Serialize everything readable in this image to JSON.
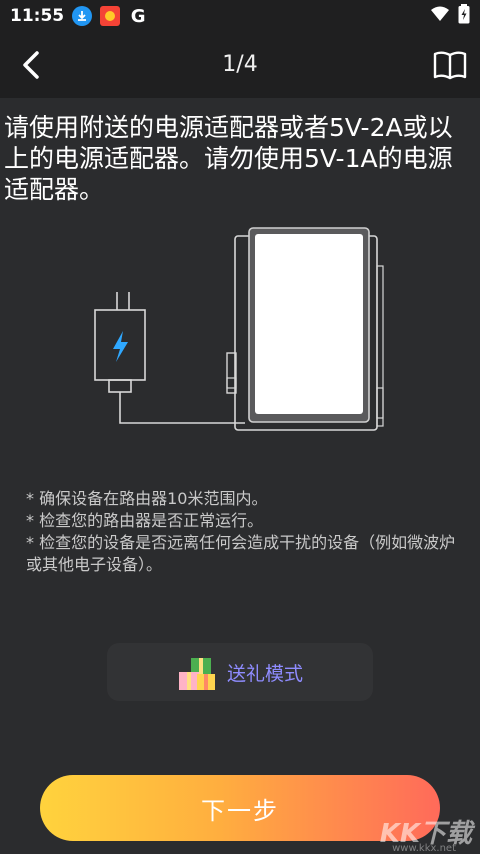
{
  "status_bar": {
    "time": "11:55",
    "icons": [
      "download-icon",
      "app-notification-icon",
      "google-icon",
      "wifi-icon",
      "battery-charging-icon"
    ],
    "g_label": "G"
  },
  "nav": {
    "page_indicator": "1/4",
    "back_icon": "chevron-left-icon",
    "manual_icon": "book-icon"
  },
  "instruction": "请使用附送的电源适配器或者5V-2A或以上的电源适配器。请勿使用5V-1A的电源适配器。",
  "tips": [
    "* 确保设备在路由器10米范围内。",
    "* 检查您的路由器是否正常运行。",
    "* 检查您的设备是否远离任何会造成干扰的设备（例如微波炉或其他电子设备）。"
  ],
  "gift_mode": {
    "label": "送礼模式",
    "icon": "gift-icon"
  },
  "next_button": {
    "label": "下一步"
  },
  "watermark": {
    "main": "KK下载",
    "sub": "www.kkx.net"
  },
  "colors": {
    "background": "#2b2c2e",
    "bar": "#1f1f20",
    "accent_purple": "#8f8cff",
    "button_gradient_start": "#ffd33d",
    "button_gradient_end": "#ff6a5a",
    "bolt": "#2fa8ff"
  }
}
